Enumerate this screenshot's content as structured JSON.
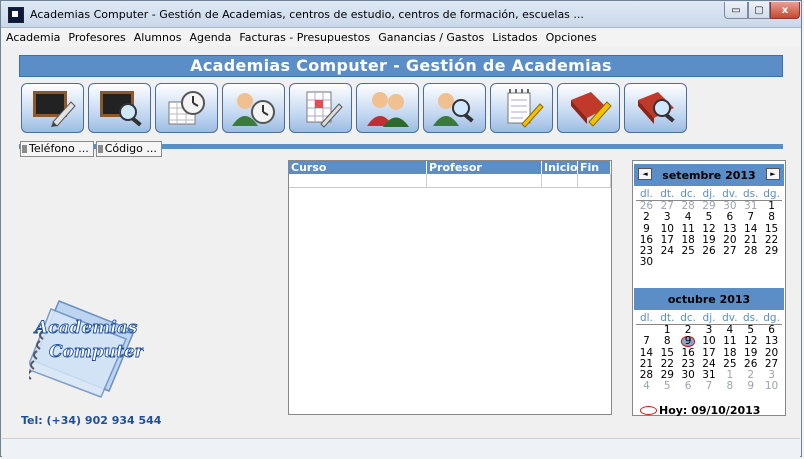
{
  "window": {
    "title": "Academias Computer - Gestión de Academias, centros de estudio, centros de formación, escuelas ...",
    "controls": {
      "minimize": "▭",
      "maximize": "▢",
      "close": "x"
    }
  },
  "menu": [
    "Academia",
    "Profesores",
    "Alumnos",
    "Agenda",
    "Facturas - Presupuestos",
    "Ganancias / Gastos",
    "Listados",
    "Opciones"
  ],
  "banner": "Academias Computer - Gestión de Academias",
  "toolbar": [
    "chalkboard-edit-icon",
    "chalkboard-search-icon",
    "calendar-clock-icon",
    "user-clock-icon",
    "grid-edit-icon",
    "users-icon",
    "user-search-icon",
    "notepad-edit-icon",
    "book-edit-icon",
    "book-search-icon"
  ],
  "tabs": [
    "Teléfono ...",
    "Código ..."
  ],
  "grid": {
    "columns": [
      "Curso",
      "Profesor",
      "Inicio",
      "Fin"
    ]
  },
  "calendar": {
    "month1": {
      "title": "setembre 2013",
      "prev": "◄",
      "next": "►"
    },
    "month2": {
      "title": "octubre 2013"
    },
    "weekdays": [
      "dl.",
      "dt.",
      "dc.",
      "dj.",
      "dv.",
      "ds.",
      "dg."
    ],
    "today": "Hoy: 09/10/2013"
  },
  "logo": {
    "line1": "Academias",
    "line2": "Computer"
  },
  "phone": "Tel: (+34) 902 934 544",
  "colors": {
    "accent": "#5b8ec7",
    "today_mark": "#d01010"
  }
}
